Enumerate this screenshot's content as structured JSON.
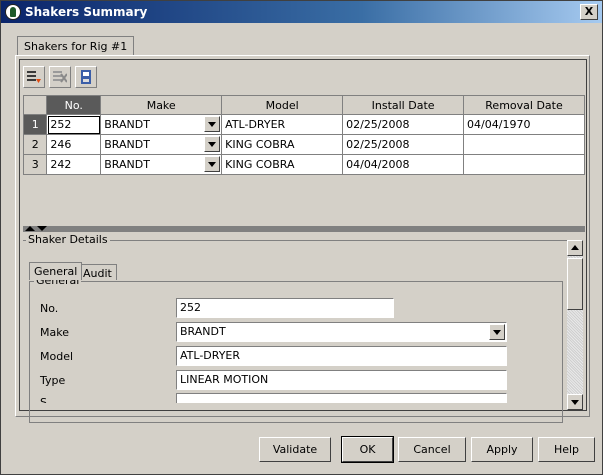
{
  "window": {
    "title": "Shakers Summary",
    "close_label": "X"
  },
  "outer_tab": "Shakers for Rig #1",
  "toolbar": {
    "icons": [
      "add-row-icon",
      "delete-row-icon",
      "save-icon"
    ]
  },
  "grid": {
    "headers": [
      "No.",
      "Make",
      "Model",
      "Install Date",
      "Removal Date"
    ],
    "rows": [
      {
        "row": "1",
        "no": "252",
        "make": "BRANDT",
        "model": "ATL-DRYER",
        "install": "02/25/2008",
        "removal": "04/04/1970"
      },
      {
        "row": "2",
        "no": "246",
        "make": "BRANDT",
        "model": "KING COBRA",
        "install": "02/25/2008",
        "removal": ""
      },
      {
        "row": "3",
        "no": "242",
        "make": "BRANDT",
        "model": "KING COBRA",
        "install": "04/04/2008",
        "removal": ""
      }
    ]
  },
  "details": {
    "legend": "Shaker Details",
    "tabs": [
      "General",
      "Audit"
    ],
    "general": {
      "legend": "General",
      "fields": [
        {
          "label": "No.",
          "value": "252"
        },
        {
          "label": "Make",
          "value": "BRANDT"
        },
        {
          "label": "Model",
          "value": "ATL-DRYER"
        },
        {
          "label": "Type",
          "value": "LINEAR MOTION"
        },
        {
          "label": "S...",
          "value": ""
        }
      ]
    }
  },
  "buttons": {
    "validate": "Validate",
    "ok": "OK",
    "cancel": "Cancel",
    "apply": "Apply",
    "help": "Help"
  }
}
